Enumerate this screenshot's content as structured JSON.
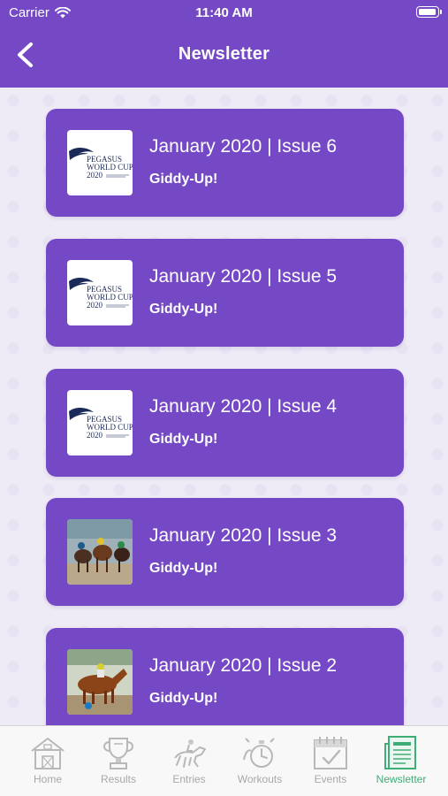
{
  "status_bar": {
    "carrier": "Carrier",
    "time": "11:40 AM"
  },
  "header": {
    "title": "Newsletter"
  },
  "newsletters": [
    {
      "title": "January 2020 | Issue 6",
      "subtitle": "Giddy-Up!",
      "thumbnail": "pegasus-logo",
      "logo_text": [
        "PEGASUS",
        "WORLD CUP",
        "2020"
      ]
    },
    {
      "title": "January 2020 | Issue 5",
      "subtitle": "Giddy-Up!",
      "thumbnail": "pegasus-logo",
      "logo_text": [
        "PEGASUS",
        "WORLD CUP",
        "2020"
      ]
    },
    {
      "title": "January 2020 | Issue 4",
      "subtitle": "Giddy-Up!",
      "thumbnail": "pegasus-logo",
      "logo_text": [
        "PEGASUS",
        "WORLD CUP",
        "2020"
      ]
    },
    {
      "title": "January 2020 | Issue 3",
      "subtitle": "Giddy-Up!",
      "thumbnail": "horse-race-photo"
    },
    {
      "title": "January 2020 | Issue 2",
      "subtitle": "Giddy-Up!",
      "thumbnail": "horse-jockey-photo"
    }
  ],
  "tabbar": {
    "items": [
      {
        "label": "Home",
        "icon": "barn-icon"
      },
      {
        "label": "Results",
        "icon": "trophy-icon"
      },
      {
        "label": "Entries",
        "icon": "horse-jockey-icon"
      },
      {
        "label": "Workouts",
        "icon": "stopwatch-icon"
      },
      {
        "label": "Events",
        "icon": "calendar-icon"
      },
      {
        "label": "Newsletter",
        "icon": "newspaper-icon"
      }
    ],
    "active": "Newsletter"
  },
  "colors": {
    "brand_purple": "#7549c6",
    "active_tab_green": "#3fae76",
    "inactive_tab_gray": "#a8a8a8"
  }
}
